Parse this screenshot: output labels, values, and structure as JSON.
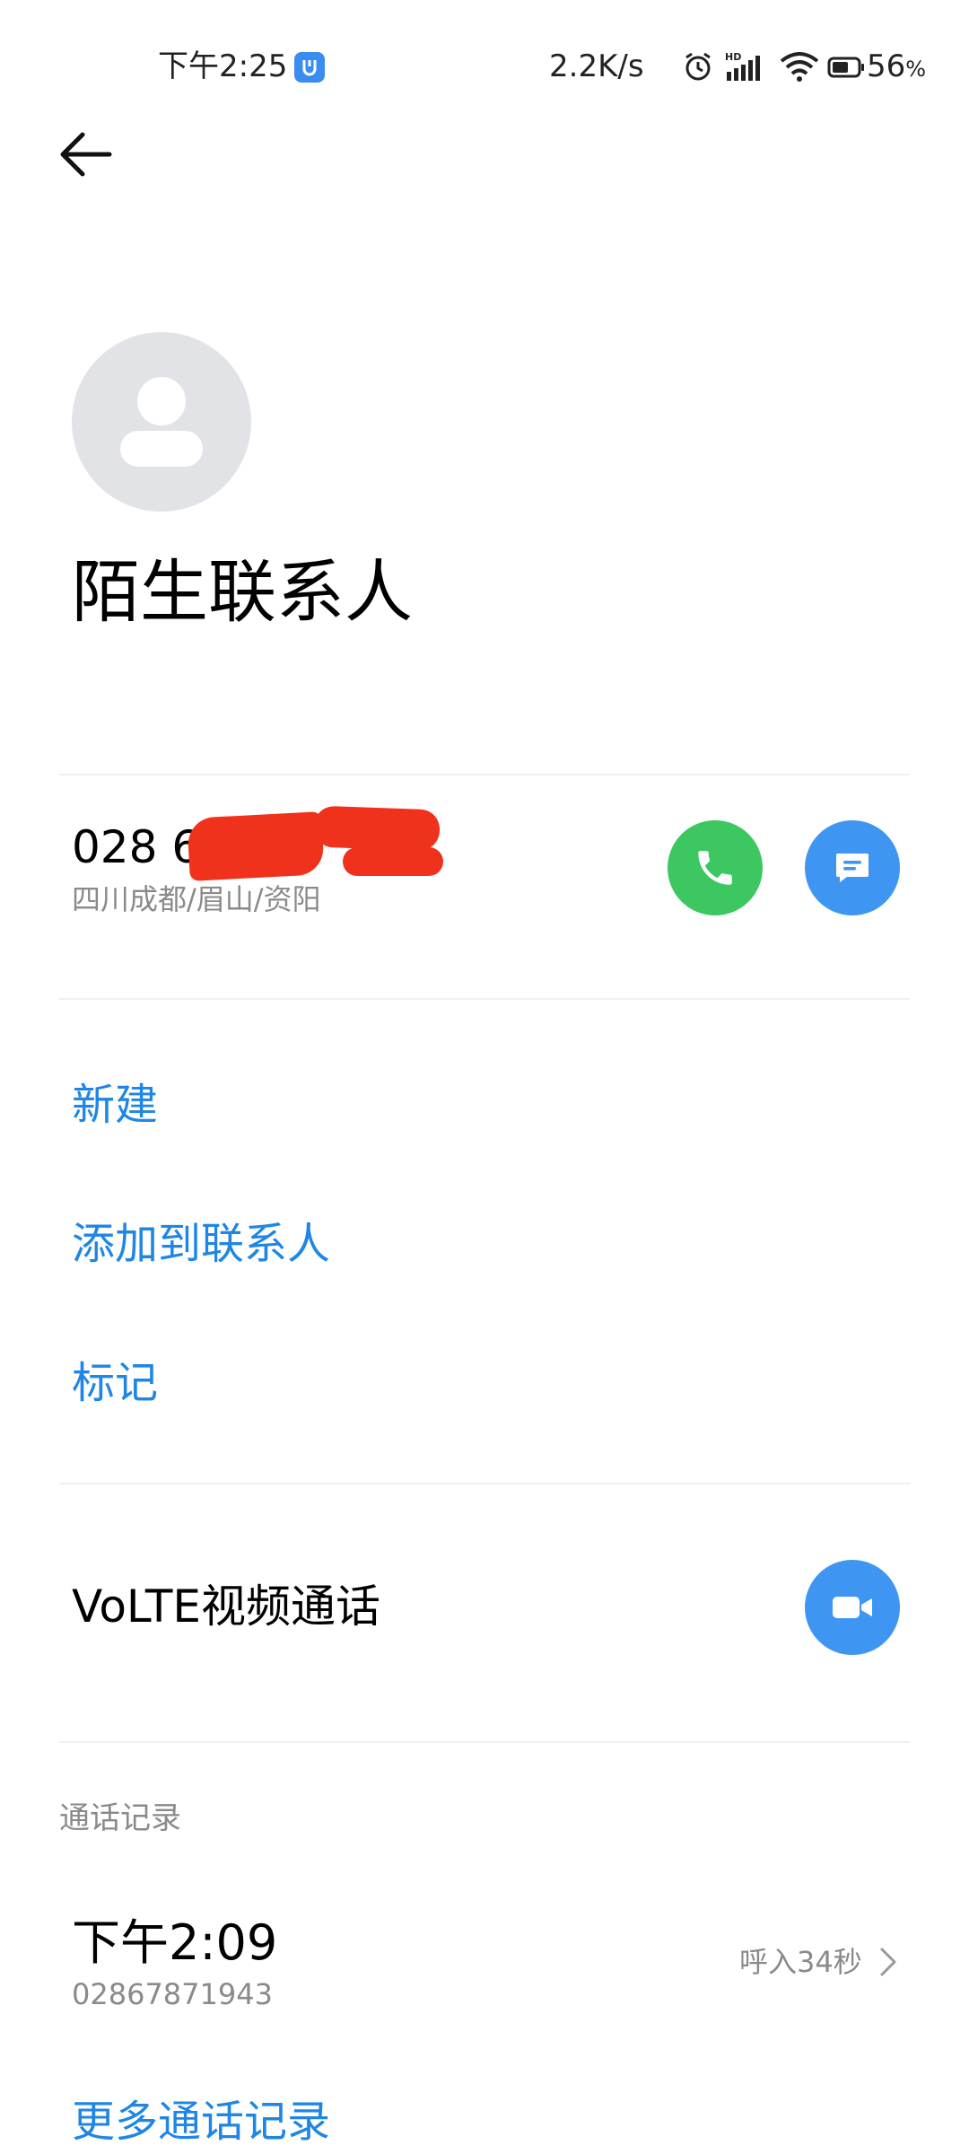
{
  "status_bar": {
    "time": "下午2:25",
    "net_speed": "2.2K/s",
    "battery_pct": "56",
    "battery_unit": "%",
    "icons": [
      "app-notification-icon",
      "alarm-icon",
      "hd-signal-icon",
      "wifi-icon",
      "battery-icon"
    ]
  },
  "header": {
    "back_icon": "back-arrow-icon"
  },
  "contact": {
    "name": "陌生联系人",
    "avatar_icon": "person-icon"
  },
  "phone": {
    "number_visible": "028 6",
    "location": "四川成都/眉山/资阳",
    "call_icon": "phone-icon",
    "message_icon": "message-icon"
  },
  "actions": [
    {
      "label": "新建"
    },
    {
      "label": "添加到联系人"
    },
    {
      "label": "标记"
    }
  ],
  "volte": {
    "label": "VoLTE视频通话",
    "video_icon": "video-camera-icon"
  },
  "call_log": {
    "section_title": "通话记录",
    "entries": [
      {
        "time": "下午2:09",
        "number": "02867871943",
        "status": "呼入34秒"
      }
    ],
    "more_label": "更多通话记录"
  },
  "colors": {
    "accent_blue": "#1f86e6",
    "call_green": "#3cc761",
    "button_blue": "#3e96f2",
    "redaction_red": "#f0321d",
    "secondary_text": "#8a8a8a"
  }
}
